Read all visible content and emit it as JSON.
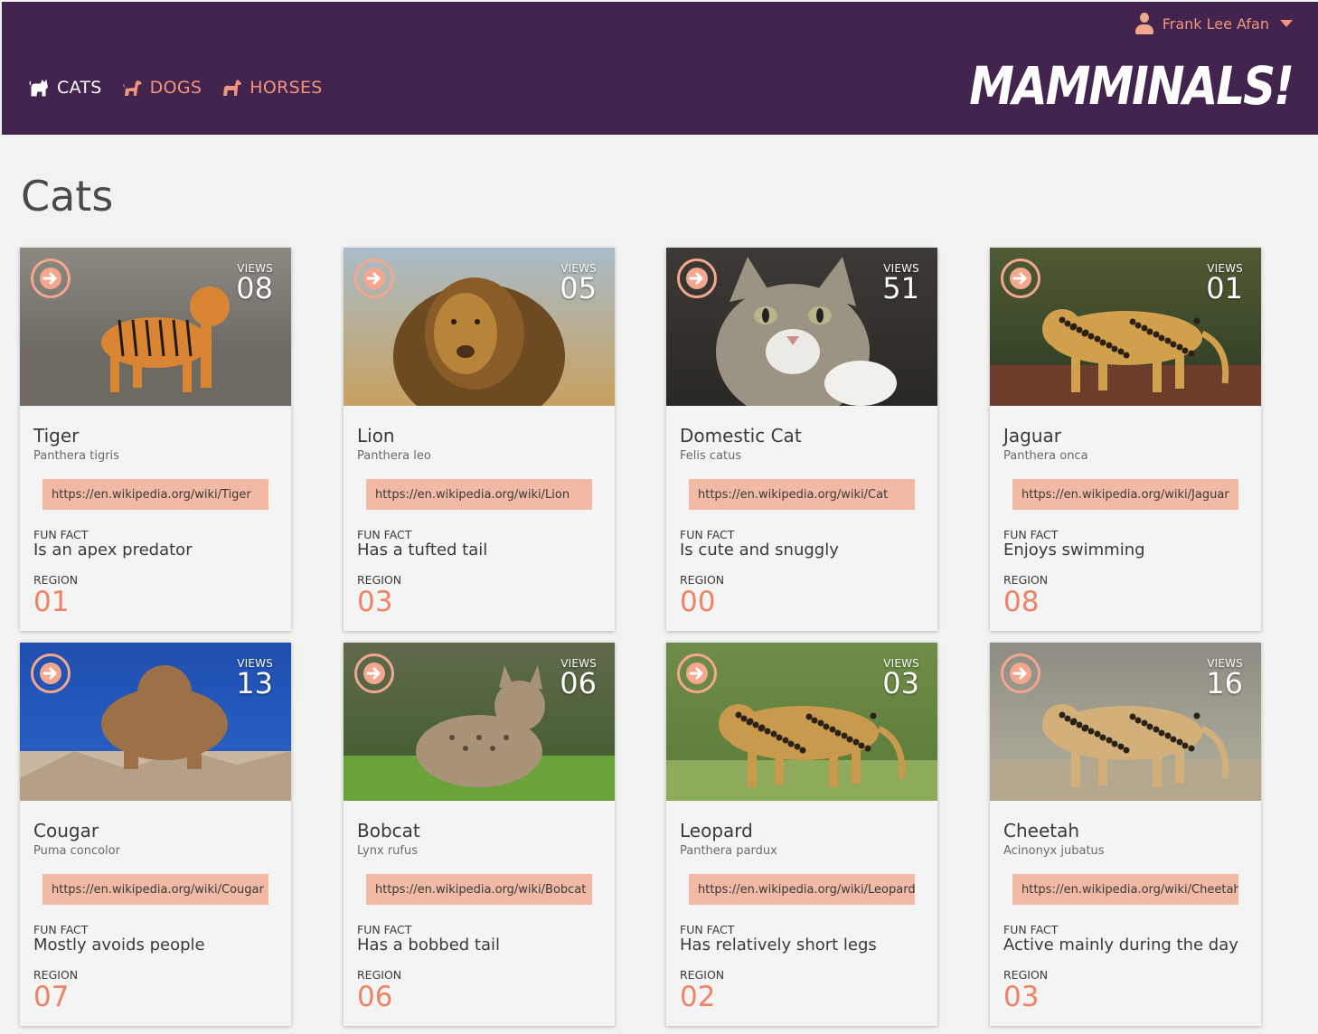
{
  "header": {
    "user_name": "Frank Lee Afan",
    "logo_text": "MAMMINALS!",
    "nav": [
      {
        "label": "CATS",
        "icon": "cat-icon",
        "active": true
      },
      {
        "label": "DOGS",
        "icon": "dog-icon",
        "active": false
      },
      {
        "label": "HORSES",
        "icon": "horse-icon",
        "active": false
      }
    ]
  },
  "page": {
    "title": "Cats"
  },
  "labels": {
    "views": "VIEWS",
    "fun_fact": "FUN FACT",
    "region": "REGION"
  },
  "colors": {
    "header_bg": "#42244f",
    "accent": "#f0957a",
    "link_bg": "#f2b9a4",
    "region": "#ee8466"
  },
  "cards": [
    {
      "name": "Tiger",
      "scientific": "Panthera tigris",
      "views": "08",
      "link": "https://en.wikipedia.org/wiki/Tiger",
      "fun_fact": "Is an apex predator",
      "region": "01",
      "photo": "tiger"
    },
    {
      "name": "Lion",
      "scientific": "Panthera leo",
      "views": "05",
      "link": "https://en.wikipedia.org/wiki/Lion",
      "fun_fact": "Has a tufted tail",
      "region": "03",
      "photo": "lion"
    },
    {
      "name": "Domestic Cat",
      "scientific": "Felis catus",
      "views": "51",
      "link": "https://en.wikipedia.org/wiki/Cat",
      "fun_fact": "Is cute and snuggly",
      "region": "00",
      "photo": "domestic-cat"
    },
    {
      "name": "Jaguar",
      "scientific": "Panthera onca",
      "views": "01",
      "link": "https://en.wikipedia.org/wiki/Jaguar",
      "fun_fact": "Enjoys swimming",
      "region": "08",
      "photo": "jaguar"
    },
    {
      "name": "Cougar",
      "scientific": "Puma concolor",
      "views": "13",
      "link": "https://en.wikipedia.org/wiki/Cougar",
      "fun_fact": "Mostly avoids people",
      "region": "07",
      "photo": "cougar"
    },
    {
      "name": "Bobcat",
      "scientific": "Lynx rufus",
      "views": "06",
      "link": "https://en.wikipedia.org/wiki/Bobcat",
      "fun_fact": "Has a bobbed tail",
      "region": "06",
      "photo": "bobcat"
    },
    {
      "name": "Leopard",
      "scientific": "Panthera pardux",
      "views": "03",
      "link": "https://en.wikipedia.org/wiki/Leopard",
      "fun_fact": "Has relatively short legs",
      "region": "02",
      "photo": "leopard"
    },
    {
      "name": "Cheetah",
      "scientific": "Acinonyx jubatus",
      "views": "16",
      "link": "https://en.wikipedia.org/wiki/Cheetah",
      "fun_fact": "Active mainly during the day",
      "region": "03",
      "photo": "cheetah"
    }
  ]
}
